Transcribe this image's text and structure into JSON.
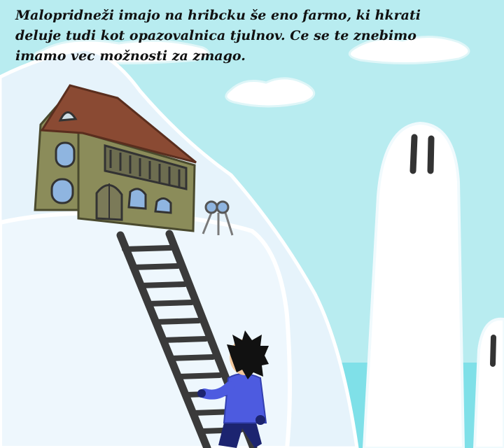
{
  "story": {
    "text": "Malopridneži imajo na hribcku še eno farmo, ki hkrati deluje tudi kot opazovalnica tjulnov. Ce se te znebimo imamo vec možnosti za zmago."
  },
  "colors": {
    "sky": "#b8ecf0",
    "snow": "#eaf6fc",
    "snow_shade": "#d6ecf6",
    "sea": "#7fe0e8",
    "roof": "#8a4a33",
    "wall": "#8b8c5a",
    "ladder": "#3a3a3a",
    "jacket": "#4d5be0",
    "pants": "#1c2470"
  },
  "icons": {
    "house": "farm-house",
    "binoculars": "binoculars-on-tripod",
    "ladder": "ladder",
    "player": "climbing-boy",
    "ghost": "snow-ghost"
  }
}
